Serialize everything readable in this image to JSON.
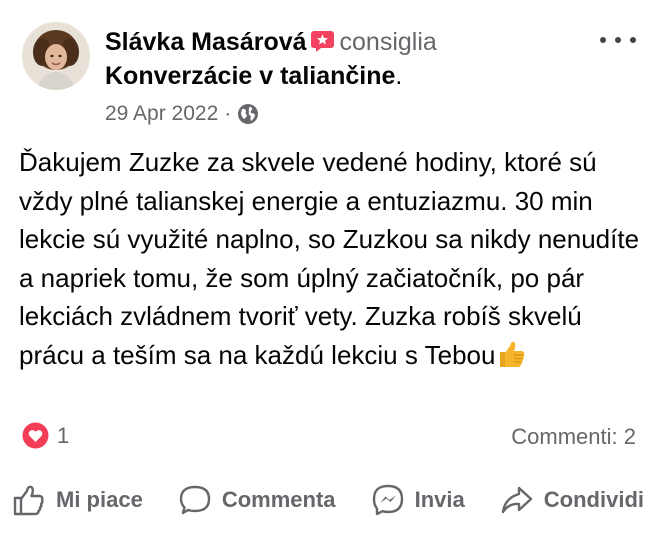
{
  "post": {
    "author": "Slávka Masárová",
    "verb": "consiglia",
    "page": "Konverzácie v taliančine",
    "page_suffix": ".",
    "date": "29 Apr 2022",
    "separator": "·",
    "privacy_icon": "globe-icon",
    "text": "Ďakujem Zuzke za skvele vedené hodiny, ktoré sú vždy plné talianskej energie a entuziazmu. 30 min lekcie sú využité naplno, so Zuzkou sa nikdy nenudíte a napriek tomu, že som úplný začiatočník, po pár lekciách zvládnem tvoriť vety. Zuzka robíš skvelú prácu a teším sa na každú lekciu s Tebou",
    "text_emoji": "thumbs-up-emoji"
  },
  "stats": {
    "reactions": "1",
    "reaction_icon": "heart-icon",
    "comments": "Commenti: 2"
  },
  "actions": [
    {
      "label": "Mi piace",
      "icon": "thumbs-up-icon"
    },
    {
      "label": "Commenta",
      "icon": "comment-bubble-icon"
    },
    {
      "label": "Invia",
      "icon": "messenger-icon"
    },
    {
      "label": "Condividi",
      "icon": "share-arrow-icon"
    }
  ],
  "colors": {
    "text": "#050505",
    "secondary": "#65676b",
    "recommend_badge": "#f3425f",
    "heart": "#f33e58",
    "emoji_yellow": "#f7b52b"
  }
}
